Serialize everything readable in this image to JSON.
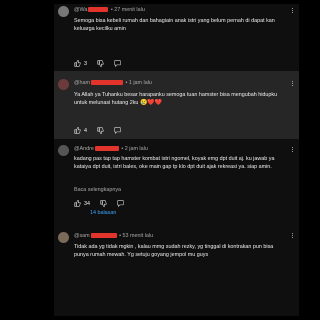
{
  "comments": [
    {
      "author": "@Wa",
      "time": "27 menit lalu",
      "text": "Semoga bisa kebeli rumah dan bahagiain anak istri yang belum pernah di dapat kan keluarga kecilku amin",
      "likes": "3"
    },
    {
      "author": "@ham",
      "time": "1 jam lalu",
      "text": "Ya Allah ya Tuhanku besar harapanku semoga tuan hamster bisa mengubah hidupku untuk melunasi hutang 2ku",
      "emoji": "😢❤️❤️",
      "likes": "4"
    },
    {
      "author": "@Andre",
      "time": "2 jam lalu",
      "text": "kadang pas tap tap hamster kombat istri ngomel, koyak emg dpt duit aj. ku jawab ya kataiya dpt duit, istri bales, oke main gap tp klo dpt duit ajak rekreasi ya. siap amin.",
      "read_more": "Baca selengkapnya",
      "likes": "34"
    },
    {
      "author": "@sam",
      "time": "53 menit lalu",
      "text": "Tidak ada yg tidak mgkin , kalau mmg sudah rezky, yg tinggal di kontrakan pun bisa punya rumah mewah. Yg setuju goyang jempol mu guys"
    }
  ],
  "replies_link": "14 balasan",
  "colors": {
    "background": "#0f0f0f",
    "highlight": "#262626",
    "redaction": "#e2342a",
    "link": "#3ea6ff"
  },
  "icons": [
    "thumb-up-icon",
    "thumb-down-icon",
    "comment-icon",
    "more-vert-icon",
    "heart-icon"
  ]
}
